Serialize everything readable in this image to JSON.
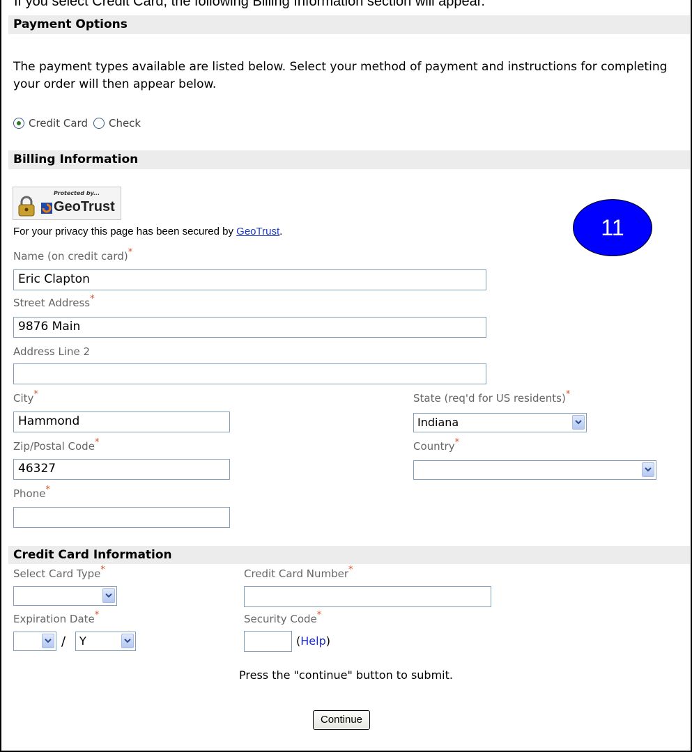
{
  "caption": "If you select Credit Card, the following Billing Information section will appear.",
  "payment": {
    "section_title": "Payment Options",
    "intro": "The payment types available are listed below. Select your method of payment and instructions for completing your order will then appear below.",
    "options": [
      {
        "label": "Credit Card",
        "selected": true
      },
      {
        "label": "Check",
        "selected": false
      }
    ]
  },
  "billing": {
    "section_title": "Billing Information",
    "seal": {
      "small_text": "Protected by...",
      "brand": "GeoTrust"
    },
    "privacy_text": "For your privacy this page has been secured by ",
    "privacy_link": "GeoTrust",
    "privacy_end": ".",
    "name_label": "Name (on credit card)",
    "name_value": "Eric Clapton",
    "street_label": "Street Address",
    "street_value": "9876 Main",
    "address2_label": "Address Line 2",
    "address2_value": "",
    "city_label": "City",
    "city_value": "Hammond",
    "state_label": "State (req'd for US residents)",
    "state_value": "Indiana",
    "zip_label": "Zip/Postal Code",
    "zip_value": "46327",
    "country_label": "Country",
    "country_value": "",
    "phone_label": "Phone",
    "phone_value": "",
    "required_mark": "*"
  },
  "callout": {
    "number": "11",
    "color": "#0000ff"
  },
  "credit_card": {
    "section_title": "Credit Card Information",
    "card_type_label": "Select Card Type",
    "card_type_value": "",
    "card_number_label": "Credit Card Number",
    "card_number_value": "",
    "expiration_label": "Expiration Date",
    "exp_month_value": "",
    "exp_separator": "/",
    "exp_year_value": "Y",
    "security_label": "Security Code",
    "security_value": "",
    "help_open": "(",
    "help_link": "Help",
    "help_close": ")"
  },
  "footer": {
    "note": "Press the \"continue\" button to submit.",
    "continue_label": "Continue"
  }
}
